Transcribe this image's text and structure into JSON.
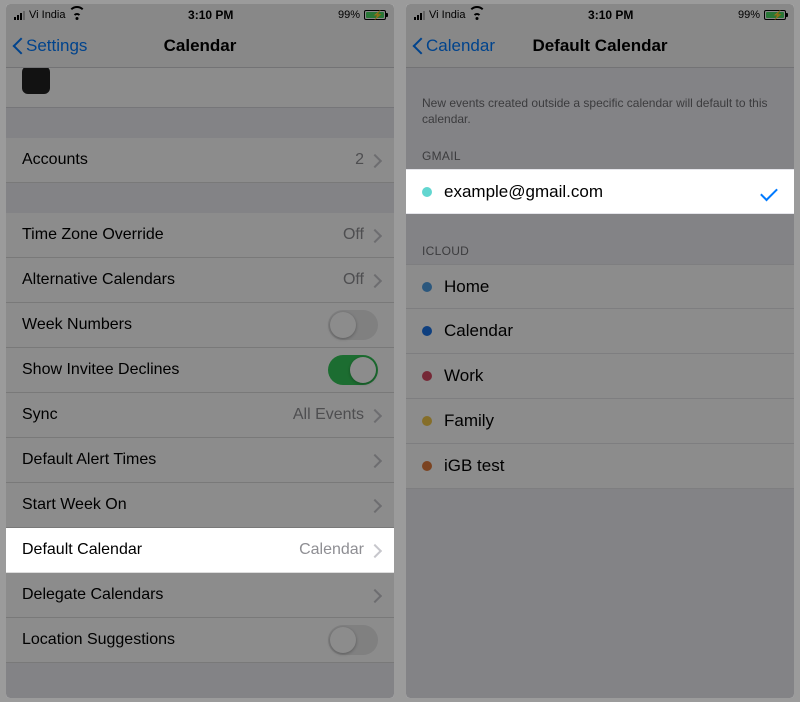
{
  "status": {
    "carrier": "Vi India",
    "time": "3:10 PM",
    "battery_pct": "99%"
  },
  "left": {
    "back_label": "Settings",
    "title": "Calendar",
    "accounts": {
      "label": "Accounts",
      "value": "2"
    },
    "settings": {
      "tz_override": {
        "label": "Time Zone Override",
        "value": "Off"
      },
      "alt_calendars": {
        "label": "Alternative Calendars",
        "value": "Off"
      },
      "week_numbers": {
        "label": "Week Numbers",
        "on": false
      },
      "invitee_declines": {
        "label": "Show Invitee Declines",
        "on": true
      },
      "sync": {
        "label": "Sync",
        "value": "All Events"
      },
      "default_alert": {
        "label": "Default Alert Times"
      },
      "start_week": {
        "label": "Start Week On"
      },
      "default_calendar": {
        "label": "Default Calendar",
        "value": "Calendar"
      },
      "delegate": {
        "label": "Delegate Calendars"
      },
      "location_sugg": {
        "label": "Location Suggestions",
        "on": false
      }
    }
  },
  "right": {
    "back_label": "Calendar",
    "title": "Default Calendar",
    "description": "New events created outside a specific calendar will default to this calendar.",
    "groups": {
      "gmail": {
        "header": "GMAIL",
        "items": [
          {
            "label": "example@gmail.com",
            "color": "#62d6d0",
            "selected": true
          }
        ]
      },
      "icloud": {
        "header": "ICLOUD",
        "items": [
          {
            "label": "Home",
            "color": "#4f9ee3",
            "selected": false
          },
          {
            "label": "Calendar",
            "color": "#1a73e8",
            "selected": false
          },
          {
            "label": "Work",
            "color": "#d64a63",
            "selected": false
          },
          {
            "label": "Family",
            "color": "#f2c94c",
            "selected": false
          },
          {
            "label": "iGB test",
            "color": "#e07b3c",
            "selected": false
          }
        ]
      }
    }
  }
}
